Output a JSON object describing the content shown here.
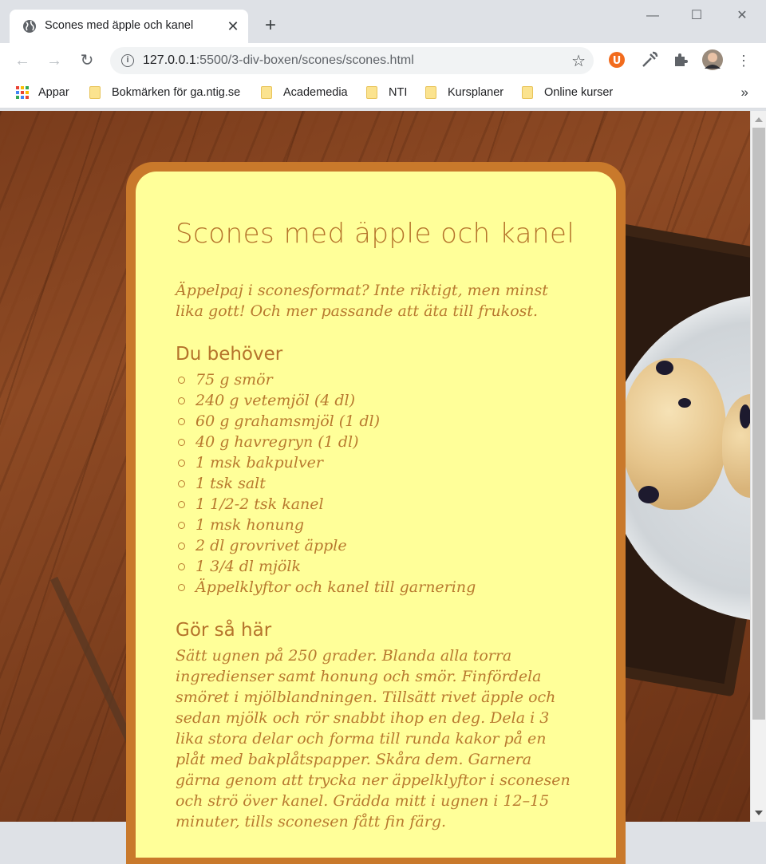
{
  "browser": {
    "tab_title": "Scones med äpple och kanel",
    "url_host": "127.0.0.1",
    "url_rest": ":5500/3-div-boxen/scones/scones.html",
    "bookmarks": [
      {
        "label": "Appar",
        "icon": "apps-grid-icon"
      },
      {
        "label": "Bokmärken för ga.ntig.se",
        "icon": "folder-icon"
      },
      {
        "label": "Academedia",
        "icon": "folder-icon"
      },
      {
        "label": "NTI",
        "icon": "folder-icon"
      },
      {
        "label": "Kursplaner",
        "icon": "folder-icon"
      },
      {
        "label": "Online kurser",
        "icon": "folder-icon"
      }
    ],
    "more_bookmarks": "»"
  },
  "recipe": {
    "title": "Scones med äpple och kanel",
    "intro": "Äppelpaj i sconesformat? Inte riktigt, men minst lika gott! Och mer passande att äta till frukost.",
    "ingredients_heading": "Du behöver",
    "ingredients": [
      "75 g smör",
      "240 g vetemjöl (4 dl)",
      "60 g grahamsmjöl (1 dl)",
      "40 g havregryn (1 dl)",
      "1 msk bakpulver",
      "1 tsk salt",
      "1 1/2-2 tsk kanel",
      "1 msk honung",
      "2 dl grovrivet äpple",
      "1 3/4 dl mjölk",
      "Äppelklyftor och kanel till garnering"
    ],
    "steps_heading": "Gör så här",
    "steps": "Sätt ugnen på 250 grader. Blanda alla torra ingredienser samt honung och smör. Finfördela smöret i mjölblandningen. Tillsätt rivet äpple och sedan mjölk och rör snabbt ihop en deg. Dela i 3 lika stora delar och forma till runda kakor på en plåt med bakplåtspapper. Skåra dem. Garnera gärna genom att trycka ner äppelklyftor i sconesen och strö över kanel. Grädda mitt i ugnen i 12–15 minuter, tills sconesen fått fin färg."
  },
  "colors": {
    "card_border": "#c9792b",
    "card_bg": "#ffff99",
    "text": "#b8792f"
  }
}
